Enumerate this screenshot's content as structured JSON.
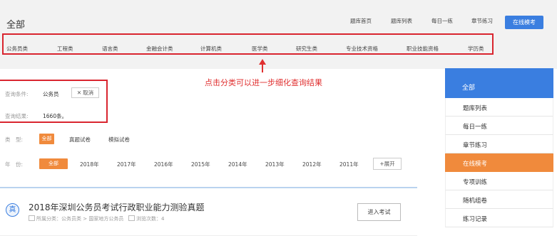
{
  "header": {
    "title": "全部",
    "nav": [
      "题库首页",
      "题库列表",
      "每日一练",
      "章节练习"
    ],
    "active_button": "在线模考"
  },
  "categories": [
    "公务员类",
    "工程类",
    "语言类",
    "金融会计类",
    "计算机类",
    "医学类",
    "研究生类",
    "专业技术资格",
    "职业技能资格",
    "学历类"
  ],
  "annotation": {
    "tip": "点击分类可以进一步细化查询结果"
  },
  "query": {
    "condition_label": "查询条件:",
    "condition_value": "公务员",
    "cancel_icon": "close-icon",
    "cancel_label": "取消",
    "result_label": "查询结果:",
    "result_value": "1660条。"
  },
  "filters": {
    "type_label": "类　型:",
    "type_options": [
      "全部",
      "真题试卷",
      "模拟试卷"
    ],
    "year_label": "年　份:",
    "year_options": [
      "全部",
      "2018年",
      "2017年",
      "2016年",
      "2015年",
      "2014年",
      "2013年",
      "2012年",
      "2011年"
    ],
    "expand_label": "+展开"
  },
  "exam": {
    "icon_text": "真",
    "title": "2018年深圳公务员考试行政职业能力测验真题",
    "category_text": "所属分类：公务员类 > 国家地方公务员",
    "views_text": "浏览次数：4",
    "enter_label": "进入考试"
  },
  "sidebar": {
    "header": "全部",
    "items": [
      "题库列表",
      "每日一练",
      "章节练习",
      "在线模考",
      "专项训练",
      "随机组卷",
      "练习记录"
    ],
    "active_index": 3
  },
  "colors": {
    "primary_blue": "#3a7ee0",
    "accent_orange": "#f08a3c",
    "annotation_red": "#d9252f"
  }
}
